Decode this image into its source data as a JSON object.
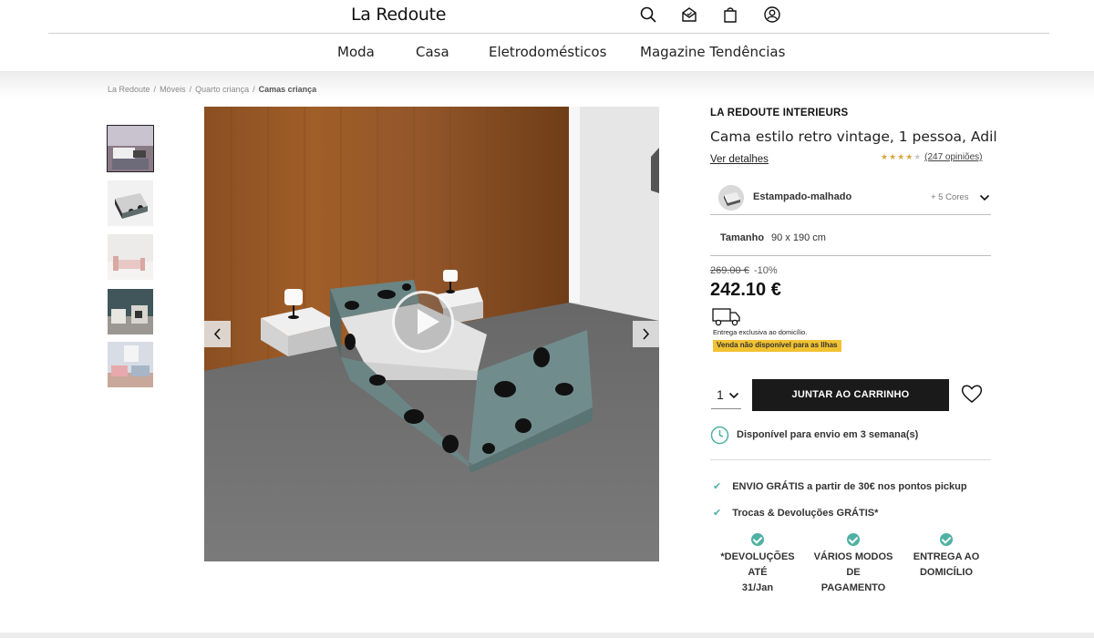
{
  "header": {
    "logo": "La Redoute",
    "nav": [
      "Moda",
      "Casa",
      "Eletrodomésticos",
      "Magazine Tendências"
    ]
  },
  "breadcrumb": [
    "La Redoute",
    "Móveis",
    "Quarto criança",
    "Camas criança"
  ],
  "product": {
    "brand": "LA REDOUTE INTERIEURS",
    "title": "Cama estilo retro vintage, 1 pessoa, Adil",
    "details_link": "Ver detalhes",
    "rating": {
      "value": 4,
      "max": 5,
      "count_label": "(247 opiniões)"
    },
    "color": {
      "name": "Estampado-malhado",
      "more": "+ 5 Cores"
    },
    "size": {
      "label": "Tamanho",
      "value": "90 x 190 cm"
    },
    "old_price": "269.00 €",
    "discount": "-10%",
    "price": "242.10 €",
    "delivery_text": "Entrega exclusiva ao domicílio.",
    "island_badge": "Venda não disponível para as Ilhas",
    "quantity": "1",
    "cart_button": "JUNTAR AO CARRINHO",
    "availability": "Disponível para envio em 3 semana(s)",
    "perks": [
      "ENVIO GRÁTIS a partir de 30€ nos pontos pickup",
      "Trocas & Devoluções GRÁTIS*"
    ],
    "features": [
      {
        "line1": "*DEVOLUÇÕES ATÉ",
        "line2": "31/Jan"
      },
      {
        "line1": "VÁRIOS MODOS DE",
        "line2": "PAGAMENTO"
      },
      {
        "line1": "ENTREGA AO",
        "line2": "DOMICÍLIO"
      }
    ]
  },
  "icons": {
    "search": "search-icon",
    "mail": "mail-icon",
    "bag": "bag-icon",
    "account": "account-icon",
    "truck": "truck-icon",
    "clock": "clock-icon",
    "heart": "heart-icon",
    "check": "check-icon"
  },
  "colors": {
    "accent_teal": "#4fb1a3",
    "badge_yellow": "#f1c232",
    "star_gold": "#d9a640",
    "button_dark": "#1a1a1a"
  }
}
